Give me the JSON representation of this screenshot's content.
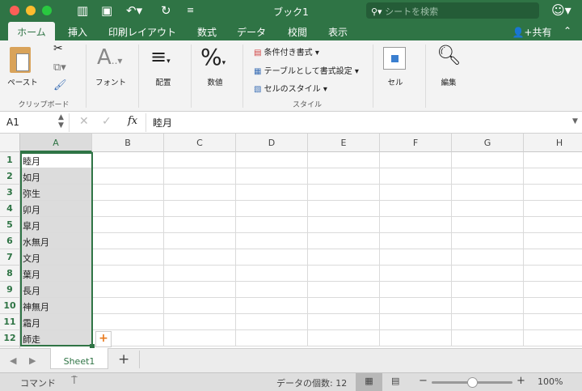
{
  "window": {
    "title": "ブック1",
    "search_placeholder": "シートを検索"
  },
  "tabs": [
    {
      "label": "ホーム",
      "active": true
    },
    {
      "label": "挿入"
    },
    {
      "label": "印刷レイアウト"
    },
    {
      "label": "数式"
    },
    {
      "label": "データ"
    },
    {
      "label": "校閲"
    },
    {
      "label": "表示"
    }
  ],
  "share_label": "共有",
  "ribbon": {
    "paste": "ペースト",
    "clipboard_group": "クリップボード",
    "font": "フォント",
    "alignment": "配置",
    "number": "数値",
    "conditional_format": "条件付き書式",
    "format_as_table": "テーブルとして書式設定",
    "cell_styles": "セルのスタイル",
    "styles_group": "スタイル",
    "cells": "セル",
    "editing": "編集"
  },
  "formula_bar": {
    "name_box": "A1",
    "fx": "fx",
    "value": "睦月"
  },
  "columns": [
    "A",
    "B",
    "C",
    "D",
    "E",
    "F",
    "G",
    "H"
  ],
  "rows": [
    "1",
    "2",
    "3",
    "4",
    "5",
    "6",
    "7",
    "8",
    "9",
    "10",
    "11",
    "12"
  ],
  "cells_A": [
    "睦月",
    "如月",
    "弥生",
    "卯月",
    "皐月",
    "水無月",
    "文月",
    "葉月",
    "長月",
    "神無月",
    "霜月",
    "師走"
  ],
  "sheet_tabs": [
    {
      "label": "Sheet1",
      "active": true
    }
  ],
  "status": {
    "mode": "コマンド",
    "count": "データの個数: 12",
    "zoom": "100%",
    "zoom_percent": 100
  },
  "colors": {
    "accent": "#2f7445"
  }
}
